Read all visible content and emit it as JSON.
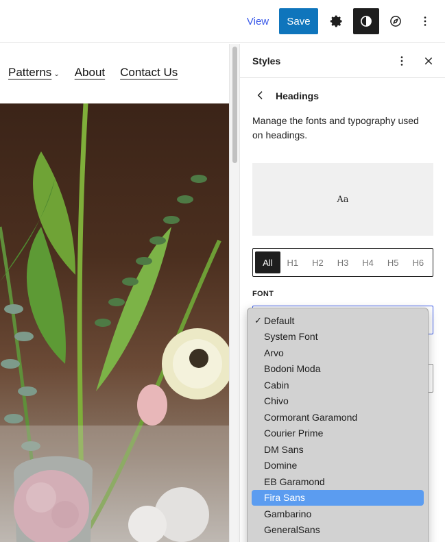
{
  "topbar": {
    "view_label": "View",
    "save_label": "Save"
  },
  "canvas": {
    "nav": [
      {
        "label": "Patterns"
      },
      {
        "label": "About"
      },
      {
        "label": "Contact Us"
      }
    ]
  },
  "sidebar": {
    "title": "Styles",
    "panel": {
      "title": "Headings",
      "description": "Manage the fonts and typography used on headings.",
      "preview_text": "Aa"
    },
    "levels": [
      "All",
      "H1",
      "H2",
      "H3",
      "H4",
      "H5",
      "H6"
    ],
    "selected_level": "All",
    "font_label": "FONT"
  },
  "font_dropdown": {
    "selected": "Default",
    "highlighted": "Fira Sans",
    "options": [
      "Default",
      "System Font",
      "Arvo",
      "Bodoni Moda",
      "Cabin",
      "Chivo",
      "Cormorant Garamond",
      "Courier Prime",
      "DM Sans",
      "Domine",
      "EB Garamond",
      "Fira Sans",
      "Gambarino",
      "GeneralSans"
    ]
  },
  "colors": {
    "accent": "#3858e9",
    "save_button": "#0f75bc",
    "highlight": "#5b9cf0"
  }
}
